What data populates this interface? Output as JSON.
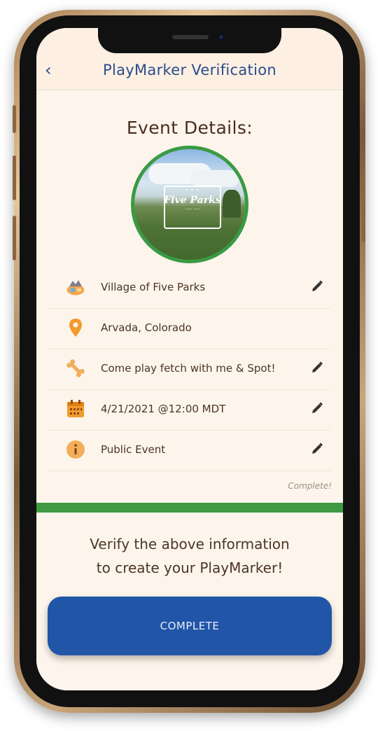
{
  "header": {
    "back_label": "‹",
    "title": "PlayMarker Verification"
  },
  "event": {
    "section_title": "Event Details:",
    "image_logo_text": "Five Parks",
    "rows": [
      {
        "icon": "playground-icon",
        "label": "Village of Five Parks",
        "editable": true
      },
      {
        "icon": "location-pin-icon",
        "label": "Arvada, Colorado",
        "editable": false
      },
      {
        "icon": "bone-icon",
        "label": "Come play fetch with me & Spot!",
        "editable": true
      },
      {
        "icon": "calendar-icon",
        "label": "4/21/2021 @12:00 MDT",
        "editable": true
      },
      {
        "icon": "info-icon",
        "label": "Public Event",
        "editable": true
      }
    ],
    "status_note": "Complete!",
    "progress": 1.0
  },
  "footer": {
    "verify_line1": "Verify the above information",
    "verify_line2": "to create your PlayMarker!",
    "complete_button": "COMPLETE"
  },
  "colors": {
    "accent_blue": "#2155a8",
    "progress_green": "#3f9a43",
    "icon_orange": "#f39a2e",
    "background": "#fdf5eb"
  }
}
